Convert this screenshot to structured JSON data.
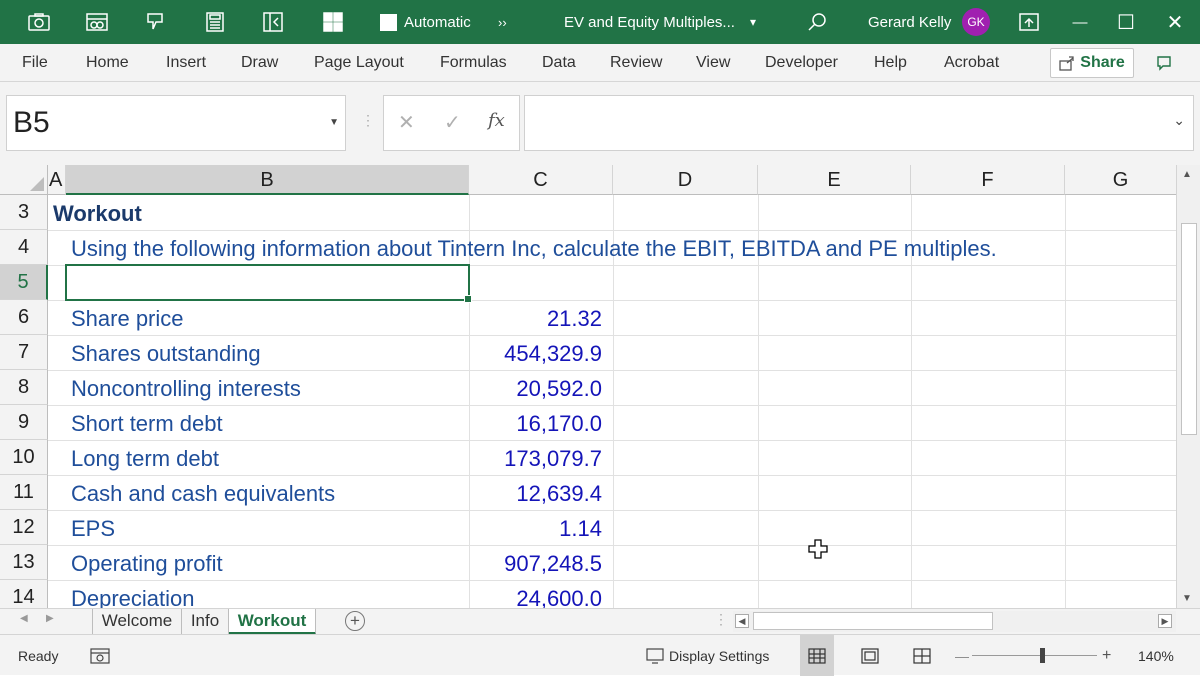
{
  "titlebar": {
    "autosave_label": "Automatic",
    "more_glyph": "››",
    "doc_title": "EV and Equity Multiples...",
    "dropdown_glyph": "▾",
    "search_icon": "search-icon",
    "user_name": "Gerard Kelly",
    "user_initials": "GK",
    "minimize_glyph": "—",
    "maximize_glyph": "☐",
    "close_glyph": "✕",
    "accent": "#217346"
  },
  "menu": {
    "items": [
      "File",
      "Home",
      "Insert",
      "Draw",
      "Page Layout",
      "Formulas",
      "Data",
      "Review",
      "View",
      "Developer",
      "Help",
      "Acrobat"
    ],
    "share_label": "Share"
  },
  "formula_bar": {
    "name_box": "B5",
    "cancel_glyph": "✕",
    "enter_glyph": "✓",
    "fx_label": "fx",
    "formula": ""
  },
  "sheet": {
    "columns": [
      "A",
      "B",
      "C",
      "D",
      "E",
      "F",
      "G"
    ],
    "selected_column": "B",
    "active_row": "5",
    "rows": [
      {
        "num": "3",
        "b": "Workout",
        "c": ""
      },
      {
        "num": "4",
        "b": "Using the following information about Tintern Inc, calculate the EBIT, EBITDA and PE multiples.",
        "c": ""
      },
      {
        "num": "5",
        "b": "",
        "c": ""
      },
      {
        "num": "6",
        "b": "Share price",
        "c": "21.32"
      },
      {
        "num": "7",
        "b": "Shares outstanding",
        "c": "454,329.9"
      },
      {
        "num": "8",
        "b": "Noncontrolling interests",
        "c": "20,592.0"
      },
      {
        "num": "9",
        "b": "Short term debt",
        "c": "16,170.0"
      },
      {
        "num": "10",
        "b": "Long term debt",
        "c": "173,079.7"
      },
      {
        "num": "11",
        "b": "Cash and cash equivalents",
        "c": "12,639.4"
      },
      {
        "num": "12",
        "b": "EPS",
        "c": "1.14"
      },
      {
        "num": "13",
        "b": "Operating profit",
        "c": "907,248.5"
      },
      {
        "num": "14",
        "b": "Depreciation",
        "c": "24,600.0"
      }
    ]
  },
  "tabs": {
    "items": [
      "Welcome",
      "Info",
      "Workout"
    ],
    "active": "Workout",
    "add_glyph": "+"
  },
  "status": {
    "ready": "Ready",
    "display_settings": "Display Settings",
    "zoom_minus": "—",
    "zoom_plus": "+",
    "zoom": "140%",
    "zoom_level": 0.55
  }
}
